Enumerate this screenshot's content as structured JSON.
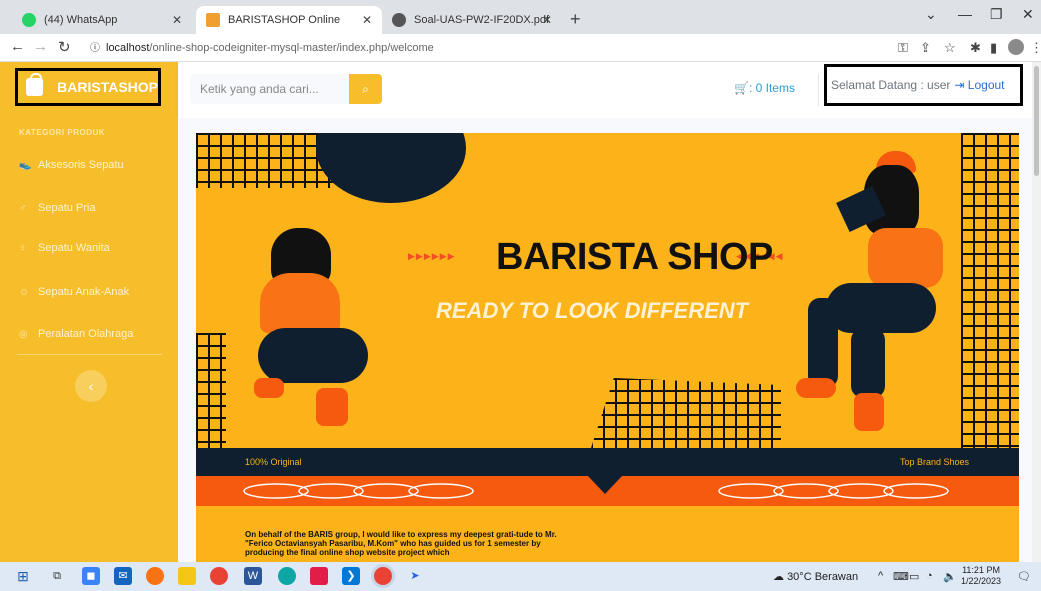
{
  "browser": {
    "tabs": [
      {
        "label": "(44) WhatsApp",
        "active": false
      },
      {
        "label": "BARISTASHOP Online",
        "active": true
      },
      {
        "label": "Soal-UAS-PW2-IF20DX.pdf",
        "active": false
      }
    ],
    "url_host": "localhost",
    "url_path": "/online-shop-codeigniter-mysql-master/index.php/welcome"
  },
  "sidebar": {
    "brand": "BARISTASHOP",
    "heading": "KATEGORI PRODUK",
    "items": [
      {
        "label": "Aksesoris Sepatu"
      },
      {
        "label": "Sepatu Pria"
      },
      {
        "label": "Sepatu Wanita"
      },
      {
        "label": "Sepatu Anak-Anak"
      },
      {
        "label": "Peralatan Olahraga"
      }
    ]
  },
  "topbar": {
    "search_placeholder": "Ketik yang anda cari...",
    "cart_label": ": 0 Items",
    "welcome": "Selamat Datang : user",
    "logout": "Logout"
  },
  "banner": {
    "title": "BARISTA SHOP",
    "subtitle": "READY TO LOOK DIFFERENT",
    "left_tag": "100% Original",
    "right_tag": "Top Brand Shoes",
    "text": "On behalf of the BARIS group, I would like to express my deepest grati-tude to Mr. \"Ferico Octaviansyah Pasaribu, M.Kom\" who has guided us for 1 semester by producing the final online shop website project which"
  },
  "taskbar": {
    "weather": "30°C  Berawan",
    "time": "11:21 PM",
    "date": "1/22/2023"
  },
  "colors": {
    "sidebar": "#f6be2b",
    "banner": "#fbb319",
    "accent_orange": "#f55a0f",
    "strip": "#0f1f2f"
  }
}
